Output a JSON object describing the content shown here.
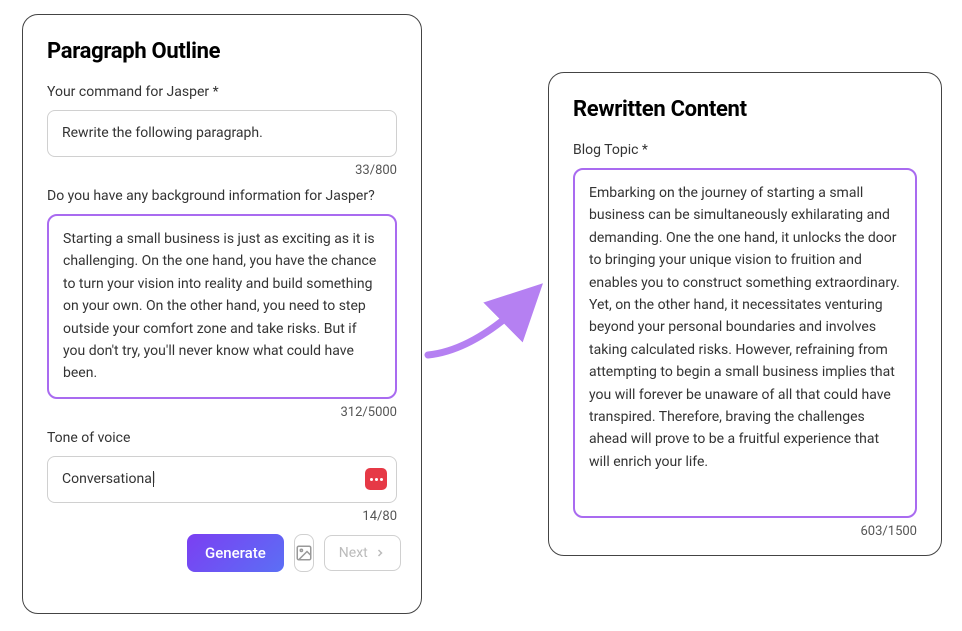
{
  "left_panel": {
    "title": "Paragraph Outline",
    "command_label": "Your command for Jasper *",
    "command_value": "Rewrite the following paragraph.",
    "command_counter": "33/800",
    "background_label": "Do you have any background information for Jasper?",
    "background_value": "Starting a small business is just as exciting as it is challenging. On the one hand, you have the chance to turn your vision into reality and build something on your own. On the other hand, you need to step outside your comfort zone and take risks. But if you don't try, you'll never know what could have been.",
    "background_counter": "312/5000",
    "tone_label": "Tone of voice",
    "tone_value": "Conversational",
    "tone_counter": "14/80",
    "generate_label": "Generate",
    "next_label": "Next"
  },
  "right_panel": {
    "title": "Rewritten Content",
    "blog_label": "Blog Topic *",
    "blog_value": "Embarking on the journey of starting a small business can be simultaneously exhilarating and demanding. One the one hand, it unlocks the door to bringing your unique vision to fruition and enables you to construct something extraordinary. Yet, on the other hand, it necessitates venturing beyond your personal boundaries and involves taking calculated risks. However, refraining from attempting to begin a small business implies that you will forever be unaware of all that could have transpired. Therefore, braving the challenges ahead will prove to be a fruitful experience that will enrich your life.",
    "blog_counter": "603/1500"
  }
}
